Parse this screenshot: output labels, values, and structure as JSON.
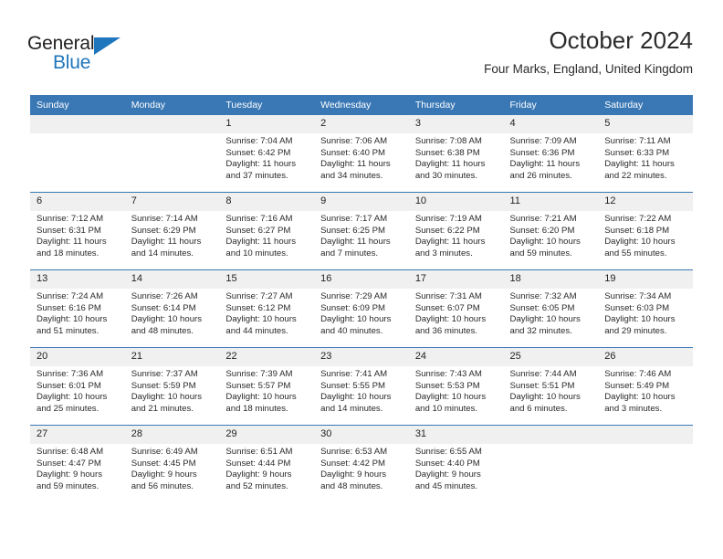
{
  "logo": {
    "word_top": "General",
    "word_bottom": "Blue",
    "triangle_color": "#1f76bc",
    "text_color": "#221f1f"
  },
  "header": {
    "title": "October 2024",
    "subtitle": "Four Marks, England, United Kingdom"
  },
  "theme": {
    "header_blue": "#3a78b5",
    "daynum_gray": "#f0f0f0",
    "text": "#2a2a2a"
  },
  "weekday_headers": [
    "Sunday",
    "Monday",
    "Tuesday",
    "Wednesday",
    "Thursday",
    "Friday",
    "Saturday"
  ],
  "weeks": [
    [
      {
        "day": "",
        "sunrise": "",
        "sunset": "",
        "daylight_line1": "",
        "daylight_line2": ""
      },
      {
        "day": "",
        "sunrise": "",
        "sunset": "",
        "daylight_line1": "",
        "daylight_line2": ""
      },
      {
        "day": "1",
        "sunrise": "Sunrise: 7:04 AM",
        "sunset": "Sunset: 6:42 PM",
        "daylight_line1": "Daylight: 11 hours",
        "daylight_line2": "and 37 minutes."
      },
      {
        "day": "2",
        "sunrise": "Sunrise: 7:06 AM",
        "sunset": "Sunset: 6:40 PM",
        "daylight_line1": "Daylight: 11 hours",
        "daylight_line2": "and 34 minutes."
      },
      {
        "day": "3",
        "sunrise": "Sunrise: 7:08 AM",
        "sunset": "Sunset: 6:38 PM",
        "daylight_line1": "Daylight: 11 hours",
        "daylight_line2": "and 30 minutes."
      },
      {
        "day": "4",
        "sunrise": "Sunrise: 7:09 AM",
        "sunset": "Sunset: 6:36 PM",
        "daylight_line1": "Daylight: 11 hours",
        "daylight_line2": "and 26 minutes."
      },
      {
        "day": "5",
        "sunrise": "Sunrise: 7:11 AM",
        "sunset": "Sunset: 6:33 PM",
        "daylight_line1": "Daylight: 11 hours",
        "daylight_line2": "and 22 minutes."
      }
    ],
    [
      {
        "day": "6",
        "sunrise": "Sunrise: 7:12 AM",
        "sunset": "Sunset: 6:31 PM",
        "daylight_line1": "Daylight: 11 hours",
        "daylight_line2": "and 18 minutes."
      },
      {
        "day": "7",
        "sunrise": "Sunrise: 7:14 AM",
        "sunset": "Sunset: 6:29 PM",
        "daylight_line1": "Daylight: 11 hours",
        "daylight_line2": "and 14 minutes."
      },
      {
        "day": "8",
        "sunrise": "Sunrise: 7:16 AM",
        "sunset": "Sunset: 6:27 PM",
        "daylight_line1": "Daylight: 11 hours",
        "daylight_line2": "and 10 minutes."
      },
      {
        "day": "9",
        "sunrise": "Sunrise: 7:17 AM",
        "sunset": "Sunset: 6:25 PM",
        "daylight_line1": "Daylight: 11 hours",
        "daylight_line2": "and 7 minutes."
      },
      {
        "day": "10",
        "sunrise": "Sunrise: 7:19 AM",
        "sunset": "Sunset: 6:22 PM",
        "daylight_line1": "Daylight: 11 hours",
        "daylight_line2": "and 3 minutes."
      },
      {
        "day": "11",
        "sunrise": "Sunrise: 7:21 AM",
        "sunset": "Sunset: 6:20 PM",
        "daylight_line1": "Daylight: 10 hours",
        "daylight_line2": "and 59 minutes."
      },
      {
        "day": "12",
        "sunrise": "Sunrise: 7:22 AM",
        "sunset": "Sunset: 6:18 PM",
        "daylight_line1": "Daylight: 10 hours",
        "daylight_line2": "and 55 minutes."
      }
    ],
    [
      {
        "day": "13",
        "sunrise": "Sunrise: 7:24 AM",
        "sunset": "Sunset: 6:16 PM",
        "daylight_line1": "Daylight: 10 hours",
        "daylight_line2": "and 51 minutes."
      },
      {
        "day": "14",
        "sunrise": "Sunrise: 7:26 AM",
        "sunset": "Sunset: 6:14 PM",
        "daylight_line1": "Daylight: 10 hours",
        "daylight_line2": "and 48 minutes."
      },
      {
        "day": "15",
        "sunrise": "Sunrise: 7:27 AM",
        "sunset": "Sunset: 6:12 PM",
        "daylight_line1": "Daylight: 10 hours",
        "daylight_line2": "and 44 minutes."
      },
      {
        "day": "16",
        "sunrise": "Sunrise: 7:29 AM",
        "sunset": "Sunset: 6:09 PM",
        "daylight_line1": "Daylight: 10 hours",
        "daylight_line2": "and 40 minutes."
      },
      {
        "day": "17",
        "sunrise": "Sunrise: 7:31 AM",
        "sunset": "Sunset: 6:07 PM",
        "daylight_line1": "Daylight: 10 hours",
        "daylight_line2": "and 36 minutes."
      },
      {
        "day": "18",
        "sunrise": "Sunrise: 7:32 AM",
        "sunset": "Sunset: 6:05 PM",
        "daylight_line1": "Daylight: 10 hours",
        "daylight_line2": "and 32 minutes."
      },
      {
        "day": "19",
        "sunrise": "Sunrise: 7:34 AM",
        "sunset": "Sunset: 6:03 PM",
        "daylight_line1": "Daylight: 10 hours",
        "daylight_line2": "and 29 minutes."
      }
    ],
    [
      {
        "day": "20",
        "sunrise": "Sunrise: 7:36 AM",
        "sunset": "Sunset: 6:01 PM",
        "daylight_line1": "Daylight: 10 hours",
        "daylight_line2": "and 25 minutes."
      },
      {
        "day": "21",
        "sunrise": "Sunrise: 7:37 AM",
        "sunset": "Sunset: 5:59 PM",
        "daylight_line1": "Daylight: 10 hours",
        "daylight_line2": "and 21 minutes."
      },
      {
        "day": "22",
        "sunrise": "Sunrise: 7:39 AM",
        "sunset": "Sunset: 5:57 PM",
        "daylight_line1": "Daylight: 10 hours",
        "daylight_line2": "and 18 minutes."
      },
      {
        "day": "23",
        "sunrise": "Sunrise: 7:41 AM",
        "sunset": "Sunset: 5:55 PM",
        "daylight_line1": "Daylight: 10 hours",
        "daylight_line2": "and 14 minutes."
      },
      {
        "day": "24",
        "sunrise": "Sunrise: 7:43 AM",
        "sunset": "Sunset: 5:53 PM",
        "daylight_line1": "Daylight: 10 hours",
        "daylight_line2": "and 10 minutes."
      },
      {
        "day": "25",
        "sunrise": "Sunrise: 7:44 AM",
        "sunset": "Sunset: 5:51 PM",
        "daylight_line1": "Daylight: 10 hours",
        "daylight_line2": "and 6 minutes."
      },
      {
        "day": "26",
        "sunrise": "Sunrise: 7:46 AM",
        "sunset": "Sunset: 5:49 PM",
        "daylight_line1": "Daylight: 10 hours",
        "daylight_line2": "and 3 minutes."
      }
    ],
    [
      {
        "day": "27",
        "sunrise": "Sunrise: 6:48 AM",
        "sunset": "Sunset: 4:47 PM",
        "daylight_line1": "Daylight: 9 hours",
        "daylight_line2": "and 59 minutes."
      },
      {
        "day": "28",
        "sunrise": "Sunrise: 6:49 AM",
        "sunset": "Sunset: 4:45 PM",
        "daylight_line1": "Daylight: 9 hours",
        "daylight_line2": "and 56 minutes."
      },
      {
        "day": "29",
        "sunrise": "Sunrise: 6:51 AM",
        "sunset": "Sunset: 4:44 PM",
        "daylight_line1": "Daylight: 9 hours",
        "daylight_line2": "and 52 minutes."
      },
      {
        "day": "30",
        "sunrise": "Sunrise: 6:53 AM",
        "sunset": "Sunset: 4:42 PM",
        "daylight_line1": "Daylight: 9 hours",
        "daylight_line2": "and 48 minutes."
      },
      {
        "day": "31",
        "sunrise": "Sunrise: 6:55 AM",
        "sunset": "Sunset: 4:40 PM",
        "daylight_line1": "Daylight: 9 hours",
        "daylight_line2": "and 45 minutes."
      },
      {
        "day": "",
        "sunrise": "",
        "sunset": "",
        "daylight_line1": "",
        "daylight_line2": ""
      },
      {
        "day": "",
        "sunrise": "",
        "sunset": "",
        "daylight_line1": "",
        "daylight_line2": ""
      }
    ]
  ]
}
